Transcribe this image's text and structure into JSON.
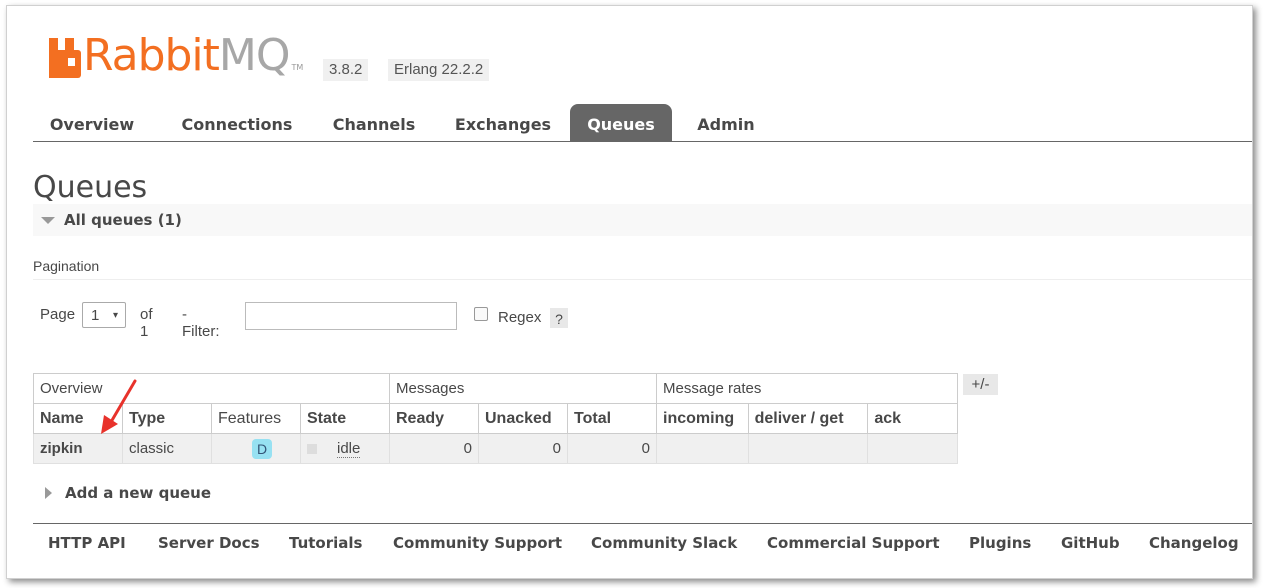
{
  "header": {
    "logo_rabbit": "Rabbit",
    "logo_mq": "MQ",
    "logo_tm": "TM",
    "version": "3.8.2",
    "erlang": "Erlang 22.2.2"
  },
  "tabs": [
    "Overview",
    "Connections",
    "Channels",
    "Exchanges",
    "Queues",
    "Admin"
  ],
  "active_tab": "Queues",
  "page_title": "Queues",
  "section_title": "All queues (1)",
  "pagination": {
    "label": "Pagination",
    "page_label": "Page",
    "page_value": "1",
    "caret": "▾",
    "of_label": "of 1",
    "filter_label": "- Filter:",
    "filter_value": "",
    "regex_label": "Regex",
    "help": "?"
  },
  "table": {
    "groups": [
      "Overview",
      "Messages",
      "Message rates"
    ],
    "columns": [
      "Name",
      "Type",
      "Features",
      "State",
      "Ready",
      "Unacked",
      "Total",
      "incoming",
      "deliver / get",
      "ack"
    ],
    "rows": [
      {
        "name": "zipkin",
        "type": "classic",
        "features": "D",
        "state": "idle",
        "ready": "0",
        "unacked": "0",
        "total": "0",
        "incoming": "",
        "deliver_get": "",
        "ack": ""
      }
    ],
    "toggle": "+/-"
  },
  "add_queue": "Add a new queue",
  "footer": [
    "HTTP API",
    "Server Docs",
    "Tutorials",
    "Community Support",
    "Community Slack",
    "Commercial Support",
    "Plugins",
    "GitHub",
    "Changelog"
  ],
  "colors": {
    "brand": "#f36f21",
    "tab_active": "#666666",
    "feature_badge": "#97e1f2",
    "annotation_arrow": "#e8322b"
  }
}
